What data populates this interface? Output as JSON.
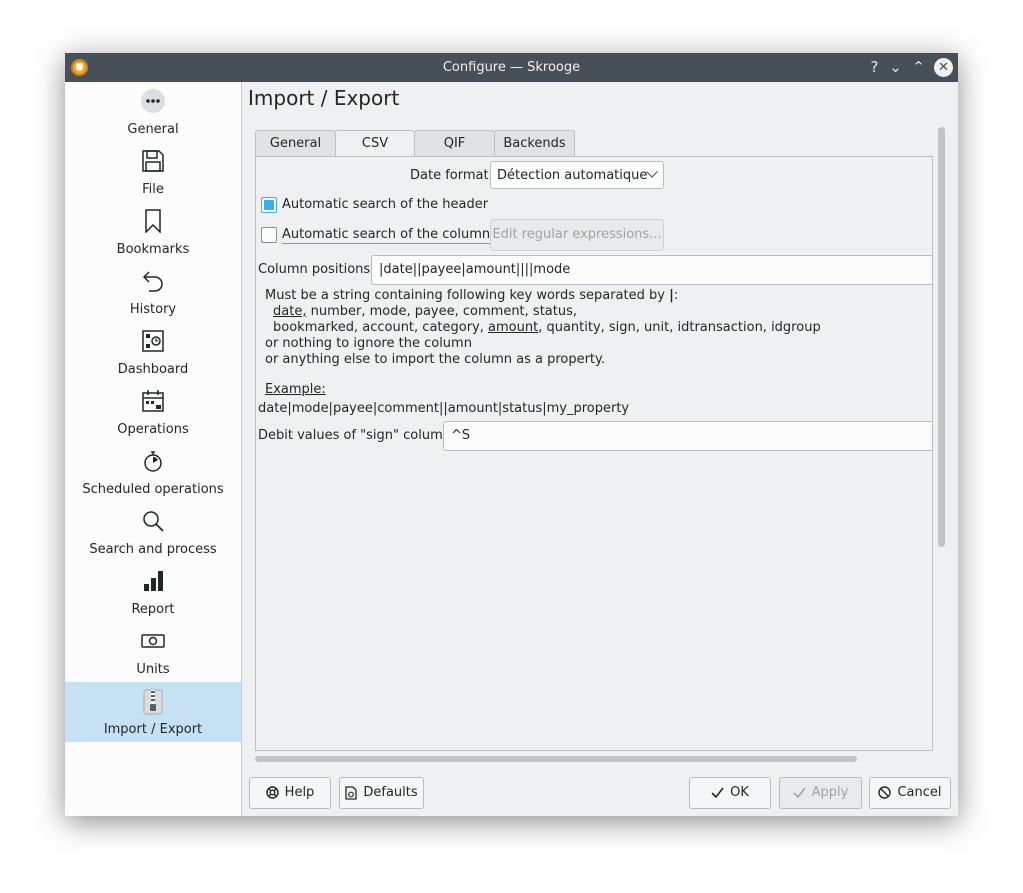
{
  "window": {
    "title": "Configure — Skrooge",
    "help_glyph": "?",
    "minimize_glyph": "⌄",
    "maximize_glyph": "⌃",
    "close_glyph": "✕"
  },
  "sidebar": {
    "items": [
      {
        "label": "General",
        "icon": "more-dots-icon"
      },
      {
        "label": "File",
        "icon": "floppy-disk-icon"
      },
      {
        "label": "Bookmarks",
        "icon": "bookmark-icon"
      },
      {
        "label": "History",
        "icon": "undo-arrow-icon"
      },
      {
        "label": "Dashboard",
        "icon": "dashboard-icon"
      },
      {
        "label": "Operations",
        "icon": "calendar-icon"
      },
      {
        "label": "Scheduled operations",
        "icon": "stopwatch-icon"
      },
      {
        "label": "Search and process",
        "icon": "search-icon"
      },
      {
        "label": "Report",
        "icon": "bar-chart-icon"
      },
      {
        "label": "Units",
        "icon": "banknote-icon"
      },
      {
        "label": "Import / Export",
        "icon": "zip-archive-icon",
        "active": true
      }
    ]
  },
  "main": {
    "title": "Import / Export",
    "tabs": [
      {
        "label": "General"
      },
      {
        "label": "CSV",
        "active": true
      },
      {
        "label": "QIF"
      },
      {
        "label": "Backends"
      }
    ],
    "csv": {
      "date_format_label": "Date format:",
      "date_format_value": "Détection automatique",
      "auto_header_label": "Automatic search of the header",
      "auto_header_checked": true,
      "auto_columns_label": "Automatic search of the columns",
      "auto_columns_checked": false,
      "edit_regex_label": "Edit regular expressions...",
      "column_positions_label": "Column positions:",
      "column_positions_value": "|date||payee|amount||||mode",
      "help": {
        "line1_prefix": "Must be a string containing following key words separated by ",
        "line1_sep": "|",
        "line1_suffix": ":",
        "line2_date": "date,",
        "line2_rest": " number, mode, payee, comment, status,",
        "line3_prefix": "bookmarked, account, category, ",
        "line3_amount": "amount",
        "line3_suffix": ", quantity, sign, unit, idtransaction, idgroup",
        "line4": "or nothing to ignore the column",
        "line5": "or anything else to import the column as a property.",
        "example_label": "Example:",
        "example_value": "date|mode|payee|comment||amount|status|my_property"
      },
      "debit_label": "Debit values of \"sign\" column:",
      "debit_value": "^S"
    }
  },
  "footer": {
    "help_label": "Help",
    "defaults_label": "Defaults",
    "ok_label": "OK",
    "apply_label": "Apply",
    "cancel_label": "Cancel"
  }
}
